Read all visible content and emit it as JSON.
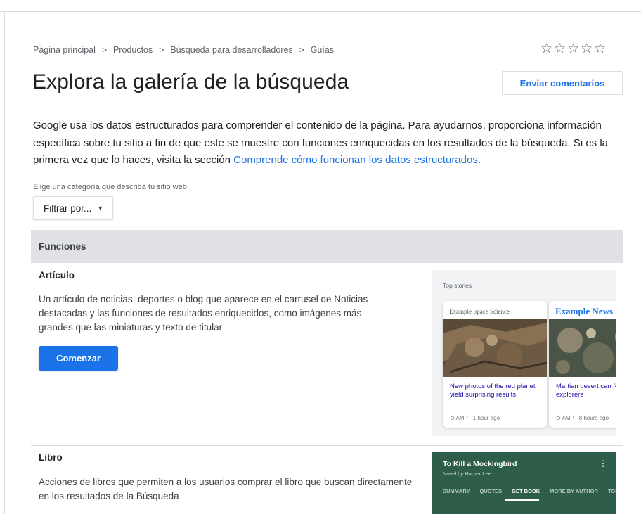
{
  "breadcrumb": {
    "items": [
      "Página principal",
      "Productos",
      "Búsqueda para desarrolladores",
      "Guías"
    ],
    "separator": ">"
  },
  "rating": {
    "stars": [
      "☆",
      "☆",
      "☆",
      "☆",
      "☆"
    ],
    "value": 0,
    "max": 5
  },
  "header": {
    "title": "Explora la galería de la búsqueda",
    "feedback_label": "Enviar comentarios"
  },
  "intro": {
    "text": "Google usa los datos estructurados para comprender el contenido de la página. Para ayudarnos, proporciona información específica sobre tu sitio a fin de que este se muestre con funciones enriquecidas en los resultados de la búsqueda. Si es la primera vez que lo haces, visita la sección ",
    "link": "Comprende cómo funcionan los datos estructurados",
    "end": "."
  },
  "filter": {
    "label": "Elige una categoría que describa tu sitio web",
    "button": "Filtrar por...",
    "caret": "▼"
  },
  "section": {
    "title": "Funciones"
  },
  "cards": [
    {
      "title": "Artículo",
      "description": "Un artículo de noticias, deportes o blog que aparece en el carrusel de Noticias destacadas y las funciones de resultados enriquecidos, como imágenes más grandes que las miniaturas y texto de titular",
      "button": "Comenzar",
      "preview": {
        "label": "Top stories",
        "stories": [
          {
            "publisher": "Example Space Science",
            "headline": "New photos of the red planet yield surprising results",
            "meta": "⊙ AMP · 1 hour ago"
          },
          {
            "publisher": "Example News",
            "headline": "Martian desert can food for explorers",
            "meta": "⊙ AMP · 8 hours ago"
          }
        ]
      }
    },
    {
      "title": "Libro",
      "description": "Acciones de libros que permiten a los usuarios comprar el libro que buscan directamente en los resultados de la Búsqueda",
      "preview": {
        "title": "To Kill a Mockingbird",
        "subtitle": "Novel by Harper Lee",
        "more": "⋮",
        "tabs": [
          "SUMMARY",
          "QUOTES",
          "GET BOOK",
          "MORE BY AUTHOR",
          "TOP"
        ]
      }
    }
  ],
  "colors": {
    "link": "#1a73e8",
    "primary_button": "#1a73e8",
    "section_header_bg": "#dfe1e5",
    "book_preview_bg": "#2e5d49"
  }
}
